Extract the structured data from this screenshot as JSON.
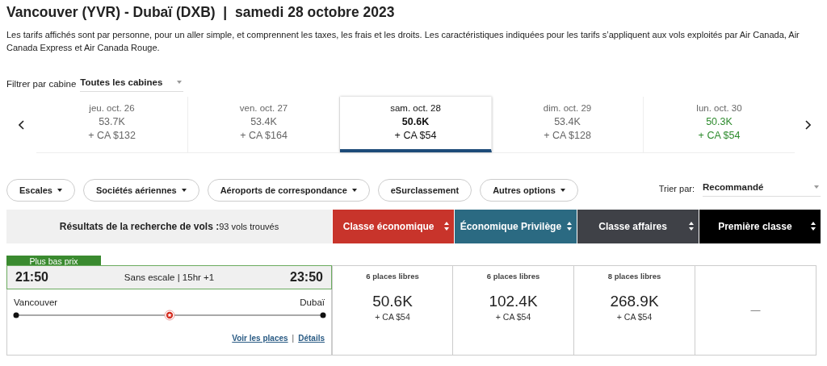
{
  "title": "Vancouver (YVR) - Dubaï (DXB)  |  samedi 28 octobre 2023",
  "notice": "Les tarifs affichés sont par personne, pour un aller simple, et comprennent les taxes, les frais et les droits. Les caractéristiques indiquées pour les tarifs s’appliquent aux vols exploités par Air Canada, Air Canada Express et Air Canada Rouge.",
  "cabin_filter": {
    "label": "Filtrer par cabine",
    "value": "Toutes les cabines"
  },
  "dates": [
    {
      "day": "jeu. oct. 26",
      "points": "53.7K",
      "cash": "+ CA $132",
      "selected": false,
      "lowest": false
    },
    {
      "day": "ven. oct. 27",
      "points": "53.4K",
      "cash": "+ CA $164",
      "selected": false,
      "lowest": false
    },
    {
      "day": "sam. oct. 28",
      "points": "50.6K",
      "cash": "+ CA $54",
      "selected": true,
      "lowest": false
    },
    {
      "day": "dim. oct. 29",
      "points": "53.4K",
      "cash": "+ CA $128",
      "selected": false,
      "lowest": false
    },
    {
      "day": "lun. oct. 30",
      "points": "50.3K",
      "cash": "+ CA $54",
      "selected": false,
      "lowest": true
    }
  ],
  "filters": [
    {
      "label": "Escales",
      "dropdown": true
    },
    {
      "label": "Sociétés aériennes",
      "dropdown": true
    },
    {
      "label": "Aéroports de correspondance",
      "dropdown": true
    },
    {
      "label": "eSurclassement",
      "dropdown": false
    },
    {
      "label": "Autres options",
      "dropdown": true
    }
  ],
  "sort": {
    "label": "Trier par:",
    "value": "Recommandé"
  },
  "results": {
    "label": "Résultats de la recherche de vols :",
    "count": "93 vols trouvés"
  },
  "cabins": [
    {
      "label": "Classe économique",
      "color": "#c8342b"
    },
    {
      "label": "Économique Privilège",
      "color": "#2b6a82"
    },
    {
      "label": "Classe affaires",
      "color": "#3f4147"
    },
    {
      "label": "Première classe",
      "color": "#000000"
    }
  ],
  "flight": {
    "badge": "Plus bas prix",
    "depart": "21:50",
    "summary": "Sans escale | 15hr +1",
    "arrive": "23:50",
    "origin": "Vancouver",
    "destination": "Dubaï",
    "links": [
      "Voir les places",
      "Détails"
    ],
    "link_separator": "|",
    "fares": [
      {
        "kind": "fare",
        "seats": "6 places libres",
        "points": "50.6K",
        "cash": "+ CA $54"
      },
      {
        "kind": "fare",
        "seats": "6 places libres",
        "points": "102.4K",
        "cash": "+ CA $54"
      },
      {
        "kind": "fare",
        "seats": "8 places libres",
        "points": "268.9K",
        "cash": "+ CA $54"
      },
      {
        "kind": "empty",
        "text": "—"
      }
    ]
  }
}
